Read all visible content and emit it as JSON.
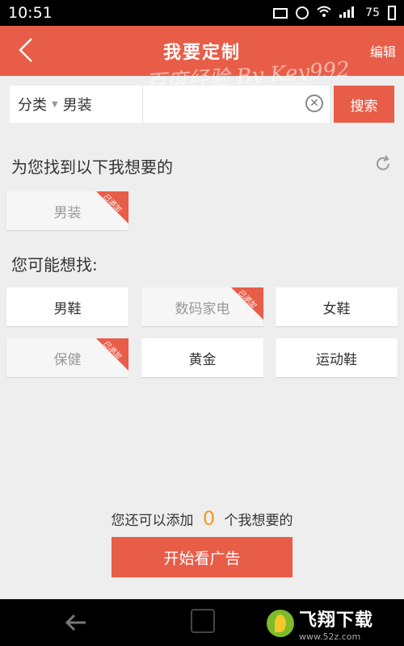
{
  "status_bar": {
    "time": "10:51",
    "battery": "75",
    "icons": [
      "image-icon",
      "alarm-icon",
      "wifi-icon",
      "signal-icon",
      "battery-icon"
    ]
  },
  "header": {
    "title": "我要定制",
    "edit_label": "编辑",
    "watermark": "百度经验 By Key992"
  },
  "search": {
    "category_label": "分类",
    "category_value": "男装",
    "placeholder": "",
    "value": "",
    "button_label": "搜索"
  },
  "found": {
    "title": "为您找到以下我想要的",
    "tags": [
      {
        "label": "男装",
        "added": true
      }
    ]
  },
  "suggest": {
    "title": "您可能想找:",
    "tags": [
      {
        "label": "男鞋",
        "added": false
      },
      {
        "label": "数码家电",
        "added": true
      },
      {
        "label": "女鞋",
        "added": false
      },
      {
        "label": "保健",
        "added": true
      },
      {
        "label": "黄金",
        "added": false
      },
      {
        "label": "运动鞋",
        "added": false
      }
    ]
  },
  "added_badge": "已添加",
  "remain": {
    "prefix": "您还可以添加",
    "count": "0",
    "suffix": "个我想要的"
  },
  "ad_button_label": "开始看广告",
  "logo": {
    "brand": "飞翔下载",
    "site": "www.52z.com"
  },
  "colors": {
    "accent": "#e85d48",
    "count": "#f39a1e"
  }
}
